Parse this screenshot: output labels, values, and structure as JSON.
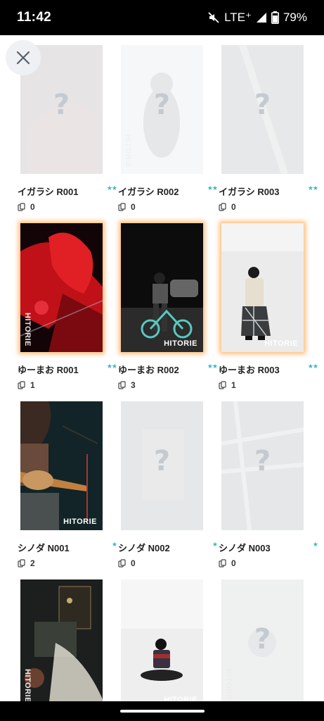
{
  "status_bar": {
    "time": "11:42",
    "network": "LTE⁺",
    "battery": "79%"
  },
  "close_icon": "close-icon",
  "cards": [
    {
      "name": "イガラシ R001",
      "stars": "★★",
      "count": "0",
      "locked": true,
      "watermark": "HITORIE"
    },
    {
      "name": "イガラシ R002",
      "stars": "★★",
      "count": "0",
      "locked": true,
      "watermark": "HITORIE"
    },
    {
      "name": "イガラシ R003",
      "stars": "★★",
      "count": "0",
      "locked": true,
      "watermark": "HITORIE"
    },
    {
      "name": "ゆーまお R001",
      "stars": "★★",
      "count": "1",
      "locked": false,
      "watermark": "HITORIE"
    },
    {
      "name": "ゆーまお R002",
      "stars": "★★",
      "count": "3",
      "locked": false,
      "watermark": "HITORIE"
    },
    {
      "name": "ゆーまお R003",
      "stars": "★★",
      "count": "1",
      "locked": false,
      "watermark": "HITORIE"
    },
    {
      "name": "シノダ N001",
      "stars": "★",
      "count": "2",
      "locked": false,
      "watermark": "HITORIE"
    },
    {
      "name": "シノダ N002",
      "stars": "★",
      "count": "0",
      "locked": true,
      "watermark": "HITORIE"
    },
    {
      "name": "シノダ N003",
      "stars": "★",
      "count": "0",
      "locked": true,
      "watermark": "HITORIE"
    },
    {
      "name": "",
      "stars": "",
      "count": "",
      "locked": false,
      "watermark": "HITORIE"
    },
    {
      "name": "",
      "stars": "",
      "count": "",
      "locked": false,
      "watermark": "HITORIE"
    },
    {
      "name": "",
      "stars": "",
      "count": "",
      "locked": true,
      "watermark": "HITORIE"
    }
  ],
  "locked_symbol": "?",
  "accent_star_color": "#3ab6c8"
}
